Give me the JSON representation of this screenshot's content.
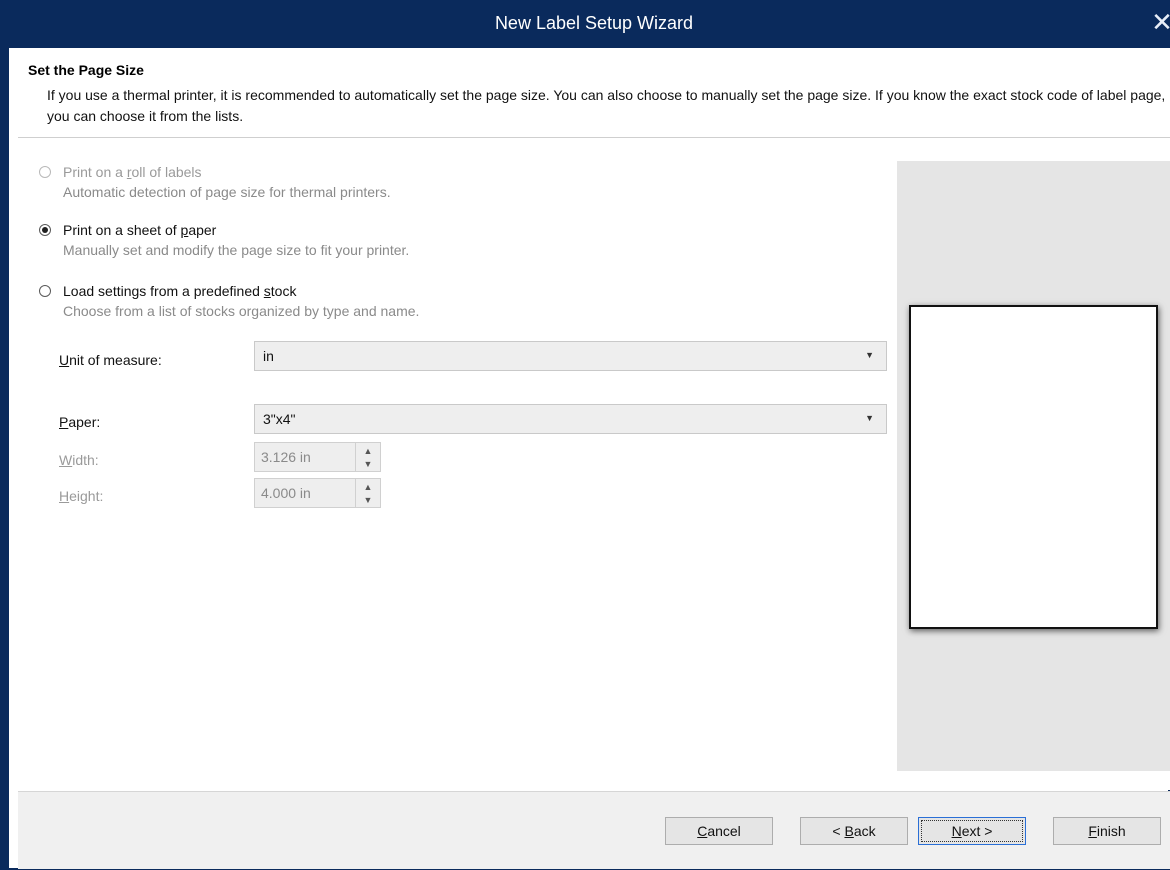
{
  "window": {
    "title": "New Label Setup Wizard",
    "close_glyph": "✕"
  },
  "header": {
    "title": "Set the Page Size",
    "description": "If you use a thermal printer, it is recommended to automatically set the page size. You can also choose to manually set the page size. If you know the exact stock code of label page, you can choose it from the lists."
  },
  "options": [
    {
      "label_pre": "Print on a ",
      "mnemonic": "r",
      "label_post": "oll of labels",
      "description": "Automatic detection of page size for thermal printers.",
      "checked": false,
      "enabled": false
    },
    {
      "label_pre": "Print on a sheet of ",
      "mnemonic": "p",
      "label_post": "aper",
      "description": "Manually set and modify the page size to fit your printer.",
      "checked": true,
      "enabled": true
    },
    {
      "label_pre": "Load settings from a predefined ",
      "mnemonic": "s",
      "label_post": "tock",
      "description": "Choose from a list of stocks organized by type and name.",
      "checked": false,
      "enabled": true
    }
  ],
  "fields": {
    "unit": {
      "mnemonic": "U",
      "label_post": "nit of measure:",
      "value": "in"
    },
    "paper": {
      "mnemonic": "P",
      "label_post": "aper:",
      "value": "3\"x4\""
    },
    "width": {
      "mnemonic": "W",
      "label_post": "idth:",
      "value": "3.126 in"
    },
    "height": {
      "mnemonic": "H",
      "label_post": "eight:",
      "value": "4.000 in"
    }
  },
  "buttons": {
    "cancel": {
      "mnemonic": "C",
      "label_post": "ancel"
    },
    "back": {
      "label_pre": "< ",
      "mnemonic": "B",
      "label_post": "ack"
    },
    "next": {
      "mnemonic": "N",
      "label_post": "ext >"
    },
    "finish": {
      "mnemonic": "F",
      "label_post": "inish"
    }
  },
  "colors": {
    "titlebar": "#0a2a5c",
    "preview_bg": "#e5e5e5",
    "default_button_border": "#2a6fd6"
  }
}
